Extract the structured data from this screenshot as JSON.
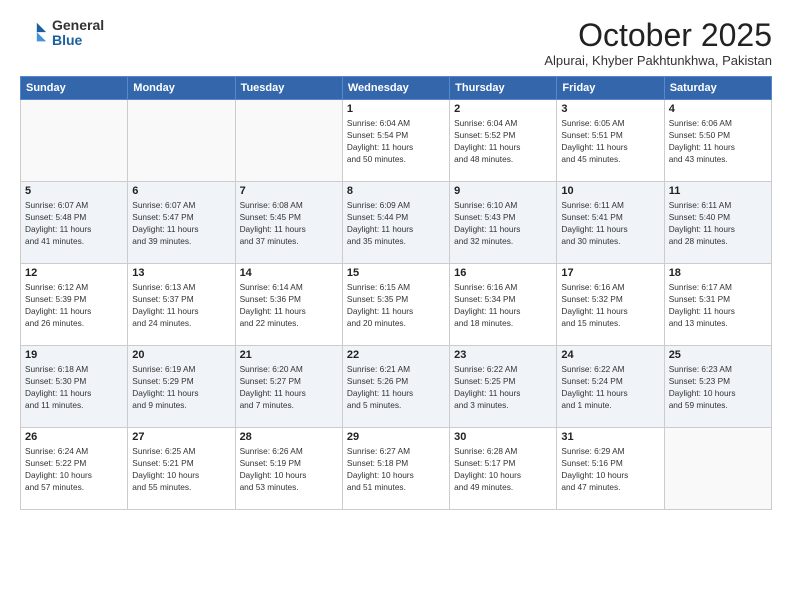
{
  "header": {
    "logo_general": "General",
    "logo_blue": "Blue",
    "month_title": "October 2025",
    "location": "Alpurai, Khyber Pakhtunkhwa, Pakistan"
  },
  "weekdays": [
    "Sunday",
    "Monday",
    "Tuesday",
    "Wednesday",
    "Thursday",
    "Friday",
    "Saturday"
  ],
  "weeks": [
    [
      {
        "day": "",
        "info": ""
      },
      {
        "day": "",
        "info": ""
      },
      {
        "day": "",
        "info": ""
      },
      {
        "day": "1",
        "info": "Sunrise: 6:04 AM\nSunset: 5:54 PM\nDaylight: 11 hours\nand 50 minutes."
      },
      {
        "day": "2",
        "info": "Sunrise: 6:04 AM\nSunset: 5:52 PM\nDaylight: 11 hours\nand 48 minutes."
      },
      {
        "day": "3",
        "info": "Sunrise: 6:05 AM\nSunset: 5:51 PM\nDaylight: 11 hours\nand 45 minutes."
      },
      {
        "day": "4",
        "info": "Sunrise: 6:06 AM\nSunset: 5:50 PM\nDaylight: 11 hours\nand 43 minutes."
      }
    ],
    [
      {
        "day": "5",
        "info": "Sunrise: 6:07 AM\nSunset: 5:48 PM\nDaylight: 11 hours\nand 41 minutes."
      },
      {
        "day": "6",
        "info": "Sunrise: 6:07 AM\nSunset: 5:47 PM\nDaylight: 11 hours\nand 39 minutes."
      },
      {
        "day": "7",
        "info": "Sunrise: 6:08 AM\nSunset: 5:45 PM\nDaylight: 11 hours\nand 37 minutes."
      },
      {
        "day": "8",
        "info": "Sunrise: 6:09 AM\nSunset: 5:44 PM\nDaylight: 11 hours\nand 35 minutes."
      },
      {
        "day": "9",
        "info": "Sunrise: 6:10 AM\nSunset: 5:43 PM\nDaylight: 11 hours\nand 32 minutes."
      },
      {
        "day": "10",
        "info": "Sunrise: 6:11 AM\nSunset: 5:41 PM\nDaylight: 11 hours\nand 30 minutes."
      },
      {
        "day": "11",
        "info": "Sunrise: 6:11 AM\nSunset: 5:40 PM\nDaylight: 11 hours\nand 28 minutes."
      }
    ],
    [
      {
        "day": "12",
        "info": "Sunrise: 6:12 AM\nSunset: 5:39 PM\nDaylight: 11 hours\nand 26 minutes."
      },
      {
        "day": "13",
        "info": "Sunrise: 6:13 AM\nSunset: 5:37 PM\nDaylight: 11 hours\nand 24 minutes."
      },
      {
        "day": "14",
        "info": "Sunrise: 6:14 AM\nSunset: 5:36 PM\nDaylight: 11 hours\nand 22 minutes."
      },
      {
        "day": "15",
        "info": "Sunrise: 6:15 AM\nSunset: 5:35 PM\nDaylight: 11 hours\nand 20 minutes."
      },
      {
        "day": "16",
        "info": "Sunrise: 6:16 AM\nSunset: 5:34 PM\nDaylight: 11 hours\nand 18 minutes."
      },
      {
        "day": "17",
        "info": "Sunrise: 6:16 AM\nSunset: 5:32 PM\nDaylight: 11 hours\nand 15 minutes."
      },
      {
        "day": "18",
        "info": "Sunrise: 6:17 AM\nSunset: 5:31 PM\nDaylight: 11 hours\nand 13 minutes."
      }
    ],
    [
      {
        "day": "19",
        "info": "Sunrise: 6:18 AM\nSunset: 5:30 PM\nDaylight: 11 hours\nand 11 minutes."
      },
      {
        "day": "20",
        "info": "Sunrise: 6:19 AM\nSunset: 5:29 PM\nDaylight: 11 hours\nand 9 minutes."
      },
      {
        "day": "21",
        "info": "Sunrise: 6:20 AM\nSunset: 5:27 PM\nDaylight: 11 hours\nand 7 minutes."
      },
      {
        "day": "22",
        "info": "Sunrise: 6:21 AM\nSunset: 5:26 PM\nDaylight: 11 hours\nand 5 minutes."
      },
      {
        "day": "23",
        "info": "Sunrise: 6:22 AM\nSunset: 5:25 PM\nDaylight: 11 hours\nand 3 minutes."
      },
      {
        "day": "24",
        "info": "Sunrise: 6:22 AM\nSunset: 5:24 PM\nDaylight: 11 hours\nand 1 minute."
      },
      {
        "day": "25",
        "info": "Sunrise: 6:23 AM\nSunset: 5:23 PM\nDaylight: 10 hours\nand 59 minutes."
      }
    ],
    [
      {
        "day": "26",
        "info": "Sunrise: 6:24 AM\nSunset: 5:22 PM\nDaylight: 10 hours\nand 57 minutes."
      },
      {
        "day": "27",
        "info": "Sunrise: 6:25 AM\nSunset: 5:21 PM\nDaylight: 10 hours\nand 55 minutes."
      },
      {
        "day": "28",
        "info": "Sunrise: 6:26 AM\nSunset: 5:19 PM\nDaylight: 10 hours\nand 53 minutes."
      },
      {
        "day": "29",
        "info": "Sunrise: 6:27 AM\nSunset: 5:18 PM\nDaylight: 10 hours\nand 51 minutes."
      },
      {
        "day": "30",
        "info": "Sunrise: 6:28 AM\nSunset: 5:17 PM\nDaylight: 10 hours\nand 49 minutes."
      },
      {
        "day": "31",
        "info": "Sunrise: 6:29 AM\nSunset: 5:16 PM\nDaylight: 10 hours\nand 47 minutes."
      },
      {
        "day": "",
        "info": ""
      }
    ]
  ]
}
